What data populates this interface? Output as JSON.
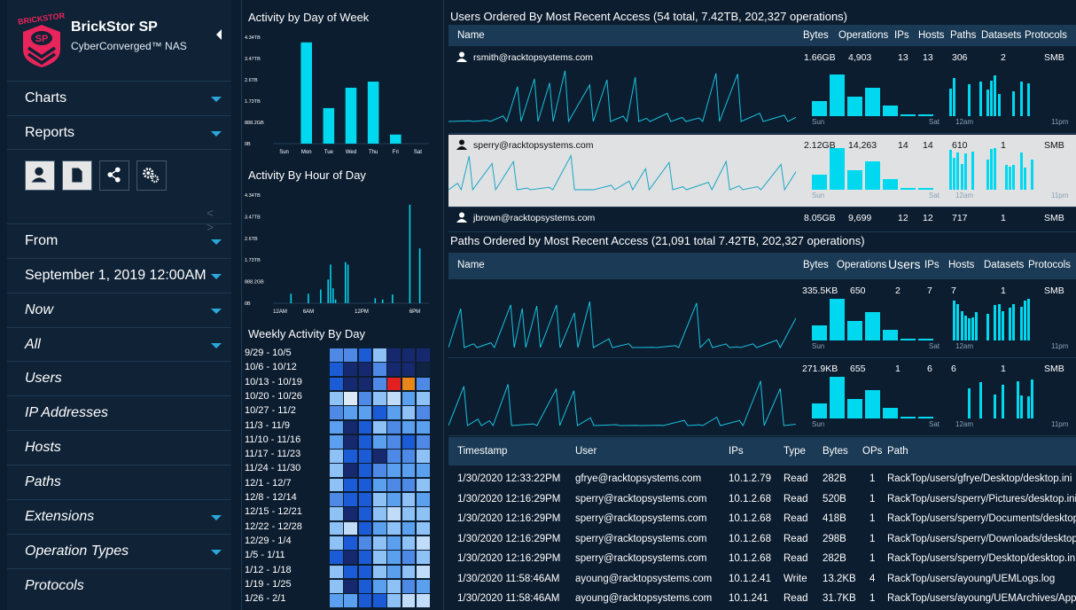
{
  "brand": {
    "title": "BrickStor SP",
    "subtitle": "CyberConverged™ NAS",
    "logo_text": "BRICKSTOR",
    "logo_badge": "SP"
  },
  "sidebar": {
    "items": [
      {
        "label": "Charts",
        "italic": false,
        "caret": true
      },
      {
        "label": "Reports",
        "italic": false,
        "caret": true
      },
      {
        "label": "From",
        "italic": false,
        "caret": true
      },
      {
        "label": "September 1, 2019 12:00AM",
        "italic": false,
        "caret": true
      },
      {
        "label": "Now",
        "italic": true,
        "caret": true
      },
      {
        "label": "All",
        "italic": true,
        "caret": true
      },
      {
        "label": "Users",
        "italic": true,
        "caret": false
      },
      {
        "label": "IP Addresses",
        "italic": true,
        "caret": false
      },
      {
        "label": "Hosts",
        "italic": true,
        "caret": false
      },
      {
        "label": "Paths",
        "italic": true,
        "caret": false
      },
      {
        "label": "Extensions",
        "italic": true,
        "caret": true
      },
      {
        "label": "Operation Types",
        "italic": true,
        "caret": true
      },
      {
        "label": "Protocols",
        "italic": true,
        "caret": false
      }
    ],
    "report_icons": [
      "user-icon",
      "file-icon",
      "share-icon",
      "gears-icon"
    ],
    "pager": "< >"
  },
  "charts": {
    "day_of_week": {
      "title": "Activity by Day of Week",
      "yticks": [
        "4.34TB",
        "3.47TB",
        "2.6TB",
        "1.73TB",
        "888.2GB",
        "0B"
      ],
      "days": [
        "Sun",
        "Mon",
        "Tue",
        "Wed",
        "Thu",
        "Fri",
        "Sat"
      ],
      "values": [
        0,
        4.13,
        1.45,
        2.28,
        2.53,
        0.37,
        0
      ]
    },
    "hour_of_day": {
      "title": "Activity By Hour of Day",
      "yticks": [
        "4.34TB",
        "3.47TB",
        "2.6TB",
        "1.73TB",
        "888.2GB",
        "0B"
      ],
      "xticks": [
        "12AM",
        "6AM",
        "12PM",
        "6PM"
      ],
      "values": [
        0,
        0,
        0,
        0,
        0,
        0,
        0,
        0.38,
        0,
        0,
        0,
        0,
        0,
        0,
        0.38,
        0,
        0,
        0,
        0,
        0.55,
        0,
        0,
        0.95,
        1.55,
        0.6,
        0.15,
        0,
        0,
        0,
        1.65,
        1.55,
        0,
        0,
        0,
        0,
        0,
        0,
        0,
        0,
        0,
        0,
        0.2,
        0,
        0,
        0.15,
        0,
        0,
        0,
        0.35,
        0,
        0,
        0,
        0,
        0,
        0,
        3.95,
        0,
        0,
        0,
        2.2,
        0,
        0,
        0
      ]
    },
    "weekly": {
      "title": "Weekly Activity By Day",
      "weeks": [
        "9/29 - 10/5",
        "10/6 - 10/12",
        "10/13 - 10/19",
        "10/20 - 10/26",
        "10/27 - 11/2",
        "11/3 - 11/9",
        "11/10 - 11/16",
        "11/17 - 11/23",
        "11/24 - 11/30",
        "12/1 - 12/7",
        "12/8 - 12/14",
        "12/15 - 12/21",
        "12/22 - 12/28",
        "12/29 - 1/4",
        "1/5 - 1/11",
        "1/12 - 1/18",
        "1/19 - 1/25",
        "1/26 - 2/1"
      ],
      "levels": [
        [
          3,
          3,
          2,
          5,
          1,
          1,
          1
        ],
        [
          2,
          1,
          1,
          3,
          1,
          1,
          0
        ],
        [
          2,
          1,
          1,
          3,
          8,
          9,
          3
        ],
        [
          5,
          7,
          3,
          5,
          6,
          4,
          5
        ],
        [
          3,
          4,
          4,
          2,
          4,
          5,
          3
        ],
        [
          4,
          1,
          2,
          5,
          3,
          4,
          4
        ],
        [
          4,
          1,
          2,
          4,
          3,
          2,
          3
        ],
        [
          5,
          2,
          2,
          1,
          3,
          3,
          5
        ],
        [
          5,
          1,
          2,
          3,
          4,
          4,
          4
        ],
        [
          5,
          2,
          2,
          4,
          3,
          3,
          5
        ],
        [
          3,
          2,
          2,
          5,
          4,
          5,
          4
        ],
        [
          5,
          1,
          2,
          5,
          6,
          5,
          5
        ],
        [
          5,
          6,
          2,
          4,
          5,
          4,
          5
        ],
        [
          5,
          2,
          3,
          5,
          4,
          5,
          6
        ],
        [
          2,
          1,
          2,
          5,
          4,
          3,
          5
        ],
        [
          5,
          2,
          2,
          5,
          4,
          5,
          6
        ],
        [
          5,
          1,
          2,
          4,
          5,
          3,
          4
        ],
        [
          4,
          4,
          2,
          2,
          5,
          6,
          6
        ]
      ],
      "palette": [
        "#0e2440",
        "#17296e",
        "#1c5bd6",
        "#4f89e6",
        "#5aa0ee",
        "#8ec2f7",
        "#c0dcf9",
        "#dbe8f5",
        "#e31f1f",
        "#e8861a"
      ]
    }
  },
  "users_table": {
    "title": "Users Ordered By Most Recent Access (54 total, 7.42TB, 202,327 operations)",
    "headers": [
      "Name",
      "Bytes",
      "Operations",
      "IPs",
      "Hosts",
      "Paths",
      "Datasets",
      "Protocols"
    ],
    "rows": [
      {
        "name": "rsmith@racktopsystems.com",
        "bytes": "1.66GB",
        "ops": "4,903",
        "ips": "13",
        "hosts": "13",
        "paths": "306",
        "datasets": "2",
        "protocols": "SMB",
        "selected": false
      },
      {
        "name": "sperry@racktopsystems.com",
        "bytes": "2.12GB",
        "ops": "14,263",
        "ips": "14",
        "hosts": "14",
        "paths": "610",
        "datasets": "1",
        "protocols": "SMB",
        "selected": true
      },
      {
        "name": "jbrown@racktopsystems.com",
        "bytes": "8.05GB",
        "ops": "9,699",
        "ips": "12",
        "hosts": "12",
        "paths": "717",
        "datasets": "1",
        "protocols": "SMB",
        "selected": false
      }
    ],
    "spark_labels": {
      "sun": "Sun",
      "sat": "Sat",
      "am": "12am",
      "pm": "11pm"
    }
  },
  "paths_table": {
    "title": "Paths Ordered by Most Recent Access (21,091 total 7.42TB, 202,327 operations)",
    "headers": [
      "Name",
      "Bytes",
      "Operations",
      "Users",
      "IPs",
      "Hosts",
      "Datasets",
      "Protocols"
    ],
    "rows": [
      {
        "bytes": "335.5KB",
        "ops": "650",
        "users": "2",
        "ips": "7",
        "hosts": "7",
        "datasets": "1",
        "protocols": "SMB"
      },
      {
        "bytes": "271.9KB",
        "ops": "655",
        "users": "1",
        "ips": "6",
        "hosts": "6",
        "datasets": "1",
        "protocols": "SMB"
      }
    ]
  },
  "log_table": {
    "headers": [
      "Timestamp",
      "User",
      "IPs",
      "Type",
      "Bytes",
      "OPs",
      "Path"
    ],
    "rows": [
      {
        "ts": "1/30/2020  12:33:22PM",
        "user": "gfrye@racktopsystems.com",
        "ip": "10.1.2.79",
        "type": "Read",
        "bytes": "282B",
        "ops": "1",
        "path": "RackTop/users/gfrye/Desktop/desktop.ini"
      },
      {
        "ts": "1/30/2020  12:16:29PM",
        "user": "sperry@racktopsystems.com",
        "ip": "10.1.2.68",
        "type": "Read",
        "bytes": "520B",
        "ops": "1",
        "path": "RackTop/users/sperry/Pictures/desktop.ini"
      },
      {
        "ts": "1/30/2020  12:16:29PM",
        "user": "sperry@racktopsystems.com",
        "ip": "10.1.2.68",
        "type": "Read",
        "bytes": "418B",
        "ops": "1",
        "path": "RackTop/users/sperry/Documents/desktop.ini"
      },
      {
        "ts": "1/30/2020  12:16:29PM",
        "user": "sperry@racktopsystems.com",
        "ip": "10.1.2.68",
        "type": "Read",
        "bytes": "298B",
        "ops": "1",
        "path": "RackTop/users/sperry/Downloads/desktop.ini"
      },
      {
        "ts": "1/30/2020  12:16:29PM",
        "user": "sperry@racktopsystems.com",
        "ip": "10.1.2.68",
        "type": "Read",
        "bytes": "282B",
        "ops": "1",
        "path": "RackTop/users/sperry/Desktop/desktop.ini"
      },
      {
        "ts": "1/30/2020  11:58:46AM",
        "user": "ayoung@racktopsystems.com",
        "ip": "10.1.2.41",
        "type": "Write",
        "bytes": "13.2KB",
        "ops": "4",
        "path": "RackTop/users/ayoung/UEMLogs.log"
      },
      {
        "ts": "1/30/2020  11:58:46AM",
        "user": "ayoung@racktopsystems.com",
        "ip": "10.1.241",
        "type": "Read",
        "bytes": "31.7KB",
        "ops": "1",
        "path": "RackTop/users/ayoung/UEMArchives/Applic"
      }
    ]
  },
  "colors": {
    "accent": "#00d8ef",
    "bg": "#0c1d30",
    "sidebar": "#0f2236",
    "header": "#1a3a55",
    "selected_row": "#dfe1e3",
    "caret": "#2aa7d8"
  }
}
